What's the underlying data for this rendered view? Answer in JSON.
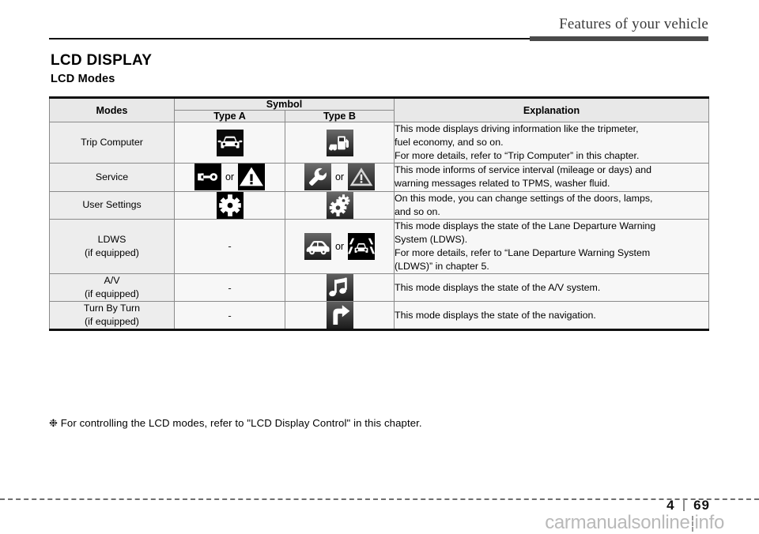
{
  "header": {
    "chapter_title": "Features of your vehicle"
  },
  "titles": {
    "h1": "LCD DISPLAY",
    "h2": "LCD Modes"
  },
  "table": {
    "headers": {
      "modes": "Modes",
      "symbol": "Symbol",
      "type_a": "Type A",
      "type_b": "Type B",
      "explanation": "Explanation"
    },
    "or_label": "or",
    "dash": "-",
    "rows": [
      {
        "mode": "Trip Computer",
        "mode_sub": "",
        "type_a_icons": [
          "car-front-icon"
        ],
        "type_b_icons": [
          "fuel-pump-car-icon"
        ],
        "explanation": [
          "This mode displays driving information like the tripmeter,",
          "fuel economy, and so on.",
          "For more details, refer to “Trip Computer” in this chapter."
        ]
      },
      {
        "mode": "Service",
        "mode_sub": "",
        "type_a_icons": [
          "wrench-flat-icon",
          "warning-triangle-icon"
        ],
        "type_b_icons": [
          "wrench-icon",
          "warning-triangle-gray-icon"
        ],
        "explanation": [
          "This mode informs of service interval (mileage or days) and",
          "warning messages related to TPMS, washer fluid."
        ]
      },
      {
        "mode": "User Settings",
        "mode_sub": "",
        "type_a_icons": [
          "gear-icon"
        ],
        "type_b_icons": [
          "double-gear-icon"
        ],
        "explanation": [
          "On this mode, you can change settings of the doors, lamps,",
          "and so on."
        ]
      },
      {
        "mode": "LDWS",
        "mode_sub": "(if equipped)",
        "type_a_icons": [],
        "type_b_icons": [
          "car-side-icon",
          "lane-departure-icon"
        ],
        "explanation": [
          "This mode displays the state of the Lane Departure Warning",
          "System (LDWS).",
          "For more details, refer to “Lane Departure Warning System",
          "(LDWS)” in chapter 5."
        ]
      },
      {
        "mode": "A/V",
        "mode_sub": "(if equipped)",
        "type_a_icons": [],
        "type_b_icons": [
          "music-note-icon"
        ],
        "explanation": [
          "This mode displays the state of the A/V system."
        ]
      },
      {
        "mode": "Turn By Turn",
        "mode_sub": "(if equipped)",
        "type_a_icons": [],
        "type_b_icons": [
          "turn-right-arrow-icon"
        ],
        "explanation": [
          "This mode displays the state of the navigation."
        ]
      }
    ]
  },
  "note": {
    "marker": "❉",
    "text": "For controlling the LCD modes, refer to \"LCD Display Control\" in this chapter."
  },
  "footer": {
    "chapter_number": "4",
    "page_number": "69",
    "watermark_left": "carmanualsonline",
    "watermark_right": "info"
  },
  "colors": {
    "header_rule_dark": "#4a4a4a",
    "table_border": "#8a8a8a",
    "table_outer_border": "#111111",
    "mode_cell_bg": "#ededed",
    "head_cell_bg": "#e8e8e8",
    "body_cell_bg": "#f7f7f7",
    "watermark": "#b9b9b9"
  }
}
